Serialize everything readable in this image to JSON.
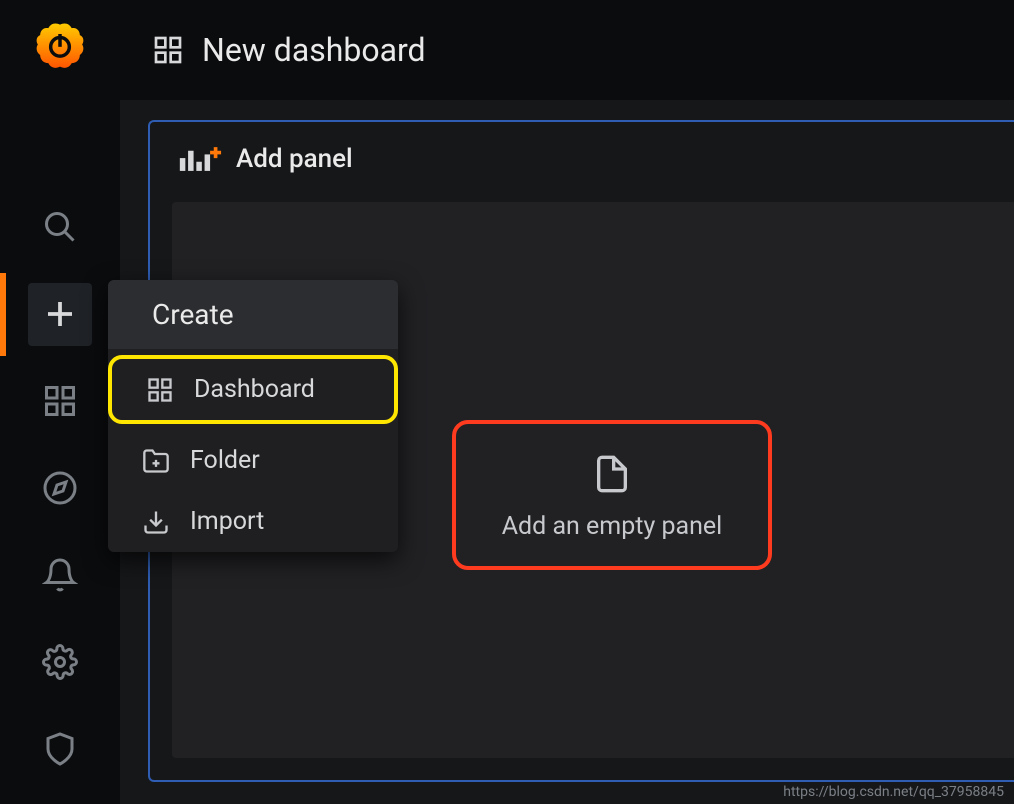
{
  "header": {
    "title": "New dashboard"
  },
  "panel": {
    "title": "Add panel",
    "empty_panel_label": "Add an empty panel"
  },
  "flyout": {
    "title": "Create",
    "items": [
      {
        "label": "Dashboard",
        "icon": "grid-icon",
        "highlighted": true
      },
      {
        "label": "Folder",
        "icon": "folder-plus-icon",
        "highlighted": false
      },
      {
        "label": "Import",
        "icon": "download-icon",
        "highlighted": false
      }
    ]
  },
  "nav": {
    "icons": [
      "search",
      "plus",
      "grid",
      "compass",
      "bell",
      "gear",
      "shield"
    ]
  },
  "watermark": "https://blog.csdn.net/qq_37958845",
  "colors": {
    "accent_orange": "#ff780a",
    "highlight_red": "#ff3b1f",
    "highlight_yellow": "#ffe600",
    "border_blue": "#2e5db3"
  }
}
